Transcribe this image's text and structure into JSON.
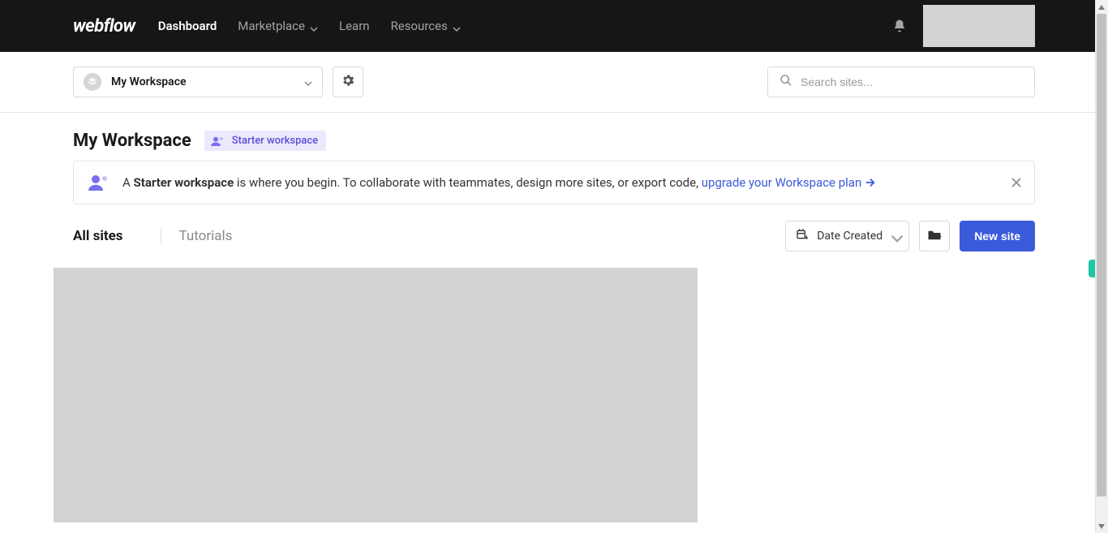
{
  "brand": "webflow",
  "nav": {
    "dashboard": "Dashboard",
    "marketplace": "Marketplace",
    "learn": "Learn",
    "resources": "Resources"
  },
  "workspace_selector": {
    "current": "My Workspace"
  },
  "search": {
    "placeholder": "Search sites..."
  },
  "page": {
    "title": "My Workspace",
    "plan_badge": "Starter workspace"
  },
  "banner": {
    "prefix": "A ",
    "strong": "Starter workspace",
    "middle": " is where you begin. To collaborate with teammates, design more sites, or export code, ",
    "link": "upgrade your Workspace plan"
  },
  "tabs": {
    "all_sites": "All sites",
    "tutorials": "Tutorials"
  },
  "sort": {
    "label": "Date Created"
  },
  "actions": {
    "new_site": "New site"
  }
}
